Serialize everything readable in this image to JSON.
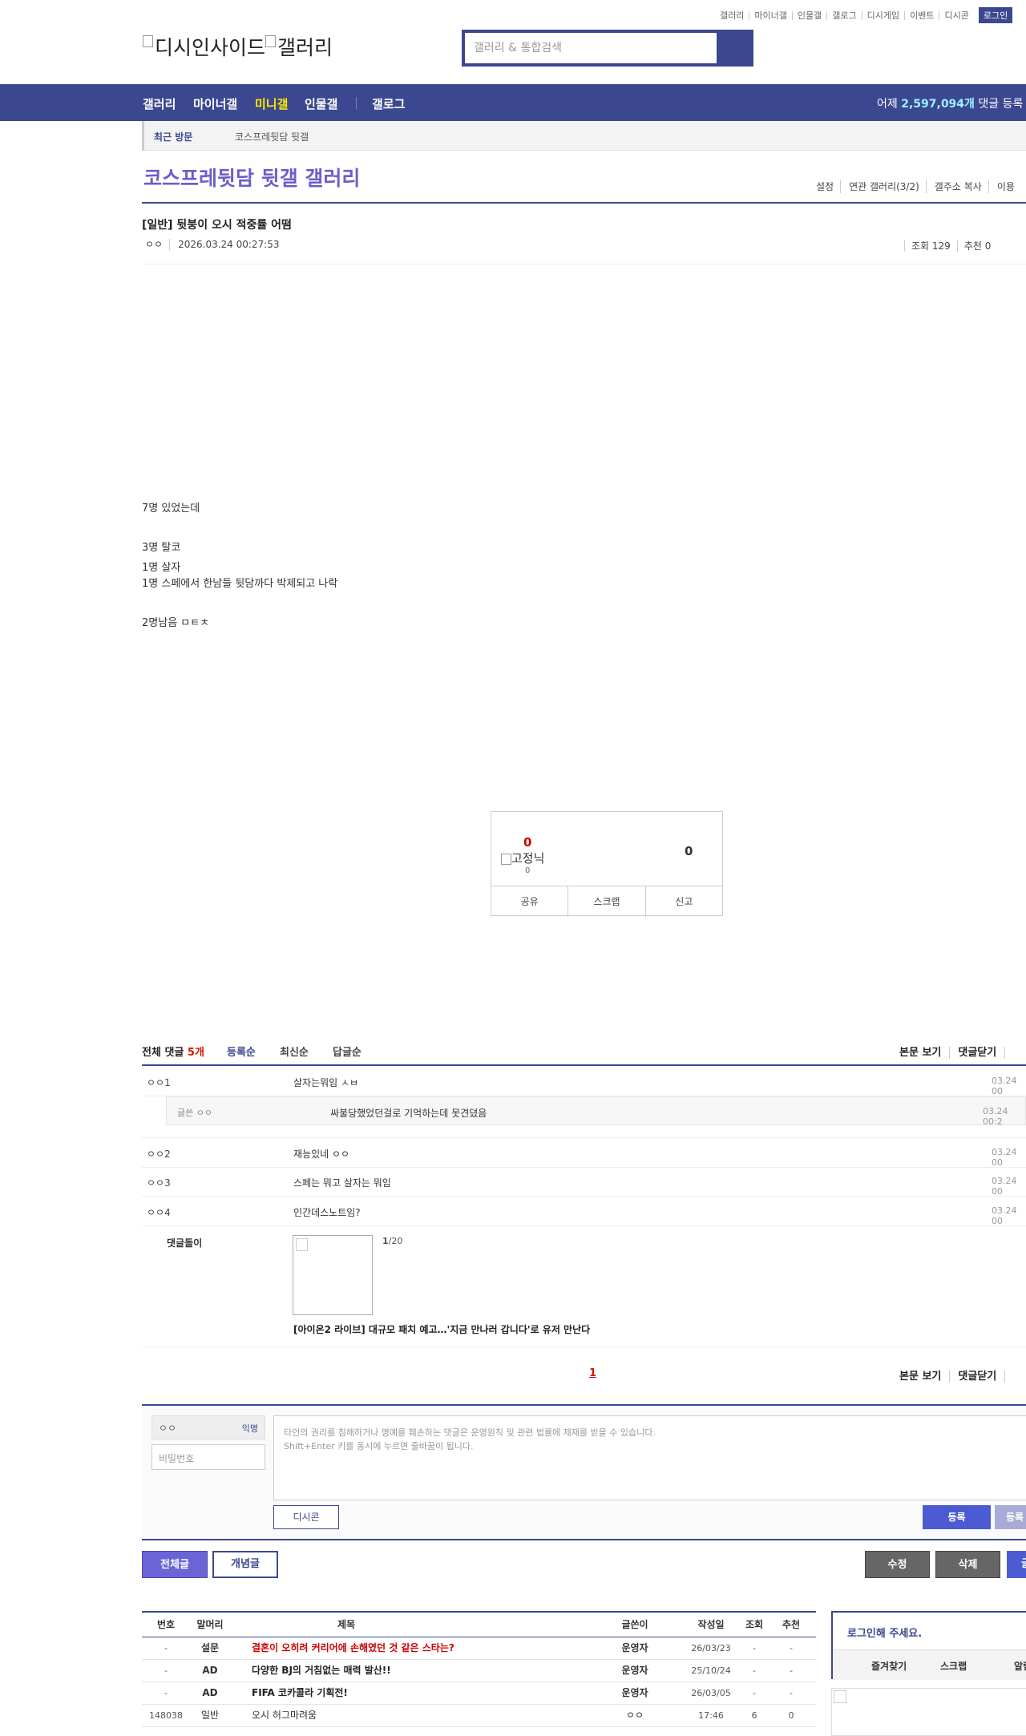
{
  "util_nav": [
    "갤러리",
    "마이너갤",
    "인물갤",
    "갤로그",
    "디시게임",
    "이벤트",
    "디시콘"
  ],
  "login_label": "로그인",
  "logo_alt": "디시인사이드",
  "logo_alt2": "갤러리",
  "search_placeholder": "갤러리 & 통합검색",
  "gnb": {
    "items": [
      "갤러리",
      "마이너갤",
      "미니갤",
      "인물갤",
      "갤로그"
    ],
    "stat_prefix": "어제",
    "stat_value": "2,597,094개",
    "stat_suffix": "댓글 등록"
  },
  "recent": {
    "label": "최근 방문",
    "gallery": "코스프레뒷담 뒷갤"
  },
  "gallery_title": "코스프레뒷담 뒷갤 갤러리",
  "gallery_options": [
    "설정",
    "연관 갤러리(3/2)",
    "갤주소 복사",
    "이용"
  ],
  "post": {
    "title": "[일반] 뒷붕이 오시 적중률 어떰",
    "author": "ㅇㅇ",
    "date": "2026.03.24 00:27:53",
    "views": "조회 129",
    "recommend": "추천 0",
    "lines": [
      "7명 있었는데",
      "3명 탈코",
      "1명 살자",
      "1명 스페에서 한남들 뒷담까다 박제되고 나락",
      "2명남음 ㅁㅌㅊ"
    ]
  },
  "vote": {
    "up": "0",
    "fix_label": "고정닉",
    "up_sub": "0",
    "down": "0",
    "actions": [
      "공유",
      "스크랩",
      "신고"
    ]
  },
  "comments": {
    "total_prefix": "전체 댓글",
    "total_count": "5개",
    "sort": [
      "등록순",
      "최신순",
      "답글순"
    ],
    "right": [
      "본문 보기",
      "댓글닫기"
    ],
    "items": [
      {
        "nick": "ㅇㅇ1",
        "text": "살자는뭐임 ㅅㅂ",
        "date": "03.24 00"
      },
      {
        "nick": "ㅇㅇ2",
        "text": "재능있네 ㅇㅇ",
        "date": "03.24 00"
      },
      {
        "nick": "ㅇㅇ3",
        "text": "스페는 뭐고 살자는 뭐임",
        "date": "03.24 00"
      },
      {
        "nick": "ㅇㅇ4",
        "text": "인간데스노트임?",
        "date": "03.24 00"
      }
    ],
    "reply": {
      "nick": "글쓴 ㅇㅇ",
      "text": "싸불당했었던걸로 기억하는데 못견뎠음",
      "date": "03.24 00:2"
    },
    "dolgi": {
      "label": "댓글돌이",
      "page_cur": "1",
      "page_total": "/20",
      "headline": "[아이온2 라이브] 대규모 패치 예고…'지금 만나러 갑니다'로 유저 만난다"
    },
    "page": "1"
  },
  "form": {
    "nick": "ㅇㅇ",
    "anon": "익명",
    "password_placeholder": "비밀번호",
    "notice1": "타인의 권리를 침해하거나 명예를 훼손하는 댓글은 운영원칙 및 관련 법률에 제재를 받을 수 있습니다.",
    "notice2": "Shift+Enter 키를 동시에 누르면 줄바꿈이 됩니다.",
    "dccon": "디시콘",
    "submit": "등록",
    "submit2": "등록"
  },
  "buttons": {
    "all": "전체글",
    "recommended": "개념글",
    "edit": "수정",
    "delete": "삭제",
    "write": "글"
  },
  "list": {
    "headers": {
      "no": "번호",
      "head": "말머리",
      "title": "제목",
      "writer": "글쓴이",
      "date": "작성일",
      "views": "조회",
      "rec": "추천"
    },
    "rows": [
      {
        "no": "-",
        "head": "설문",
        "title": "결혼이 오히려 커리어에 손해였던 것 같은 스타는?",
        "writer": "운영자",
        "date": "26/03/23",
        "views": "-",
        "rec": "-",
        "style": "red"
      },
      {
        "no": "-",
        "head": "AD",
        "title": "다양한 BJ의 거침없는 매력 발산!!",
        "writer": "운영자",
        "date": "25/10/24",
        "views": "-",
        "rec": "-",
        "style": "bold"
      },
      {
        "no": "-",
        "head": "AD",
        "title": "FIFA 코카콜라 기획전!",
        "writer": "운영자",
        "date": "26/03/05",
        "views": "-",
        "rec": "-",
        "style": "bold"
      },
      {
        "no": "148038",
        "head": "일반",
        "title": "오시 허그마려움",
        "writer": "ㅇㅇ",
        "date": "17:46",
        "views": "6",
        "rec": "0",
        "style": ""
      }
    ]
  },
  "login_box": {
    "title": "로그인해 주세요.",
    "links": [
      "즐겨찾기",
      "스크랩",
      "알림"
    ]
  },
  "colors": {
    "brand": "#3b4890",
    "accent_title": "#6a5fc8",
    "highlight": "#ffea00",
    "count": "#9ef1ff",
    "red": "#d31900"
  }
}
